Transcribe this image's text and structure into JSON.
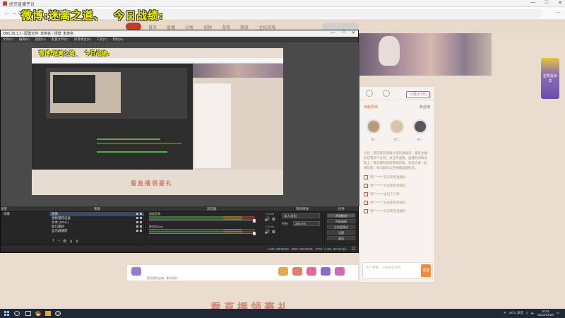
{
  "browser": {
    "tab_title": "虎牙直播平台",
    "window_buttons": [
      "—",
      "□",
      "✕"
    ],
    "nav_buttons": [
      "←",
      "→",
      "⟳"
    ],
    "menu": "⋯"
  },
  "overlay": {
    "text": "微博:迷离之道、  今日战绩:"
  },
  "site": {
    "nav_links": [
      "首页",
      "直播",
      "分类",
      "视频",
      "游戏",
      "赛事",
      "主机游戏"
    ],
    "promo_label": "星秀嘉年华",
    "side": {
      "subscribe_label": "订阅(1.5万)",
      "head_left": "贡献周榜",
      "head_right": "粉丝榜",
      "avatar_names": [
        "榜一",
        "榜二",
        "榜三"
      ],
      "notice": "公告：欢迎来到迷离之道的直播间，喜欢主播的记得点个订阅，关注不迷路。直播时间每天晚上，每天都有新的游戏内容，欢迎大家一起来玩耍，有问题可以在弹幕里面提问。",
      "messages": [
        "用户***** 欢迎来到直播间",
        "用户***** 欢迎来到直播间",
        "用户***** 送出了礼物",
        "用户***** 欢迎来到直播间",
        "用户***** 欢迎来到直播间"
      ],
      "chat_placeholder": "发个弹幕，与主播互动吧",
      "send_label": "发送"
    },
    "bottom_text": "看直播领宝箱 · 更多精彩",
    "watermark": "看直播领豪礼"
  },
  "obs": {
    "title": "OBS 26.1.1 - 配置文件: 未命名 - 场景: 未命名",
    "menu": [
      "文件(F)",
      "编辑(E)",
      "视图(V)",
      "配置文件(P)",
      "场景集合(S)",
      "工具(T)",
      "帮助(H)"
    ],
    "canvas_overlay": "微博:迷离之道、  今日战绩:",
    "canvas_lower_text": "看直播领豪礼",
    "dock_titles": [
      "场景",
      "来源",
      "混音器",
      "转场特效",
      "控件"
    ],
    "scenes": [
      "场景"
    ],
    "sources": [
      {
        "name": "图像",
        "selected": true
      },
      {
        "name": "视频捕获设备",
        "selected": false
      },
      {
        "name": "文本 (GDI+)",
        "selected": false
      },
      {
        "name": "窗口捕获",
        "selected": false
      },
      {
        "name": "显示器捕获",
        "selected": false
      }
    ],
    "dock_tools": [
      "+",
      "−",
      "⚙",
      "∧",
      "∨"
    ],
    "mixer": [
      {
        "label": "桌面音频",
        "db": "0.0 dB"
      },
      {
        "label": "麦克风/Aux",
        "db": "0.0 dB"
      }
    ],
    "transition": {
      "label": "淡入淡出",
      "duration_label": "时长",
      "duration": "300 ms"
    },
    "controls": [
      "开始推流",
      "开始录制",
      "工作室模式",
      "设置",
      "退出"
    ],
    "status": {
      "live": "LIVE: 00:00:00",
      "rec": "REC: 00:00:00",
      "cpu": "CPU: 1.4%, 30.00 fps"
    }
  },
  "taskbar": {
    "temp": "28°C 多云",
    "time": "10:01",
    "date": "2021/12/29"
  }
}
